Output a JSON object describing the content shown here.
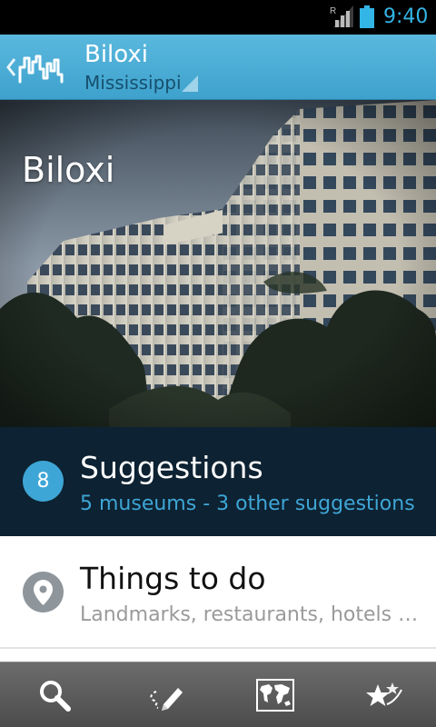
{
  "status_bar": {
    "time": "9:40",
    "network_label": "R",
    "icons": [
      "signal-icon",
      "battery-icon"
    ]
  },
  "action_bar": {
    "title": "Biloxi",
    "subtitle": "Mississippi",
    "icons": [
      "up-chevron-icon",
      "skyline-logo-icon",
      "spinner-arrow-icon"
    ]
  },
  "hero": {
    "title": "Biloxi"
  },
  "suggestions": {
    "count": "8",
    "title": "Suggestions",
    "subtitle": "5 museums - 3 other suggestions"
  },
  "things_to_do": {
    "title": "Things to do",
    "subtitle": "Landmarks, restaurants, hotels …",
    "icon": "map-pin-icon"
  },
  "bottom_bar": {
    "items": [
      "search-icon",
      "itinerary-pencil-icon",
      "world-map-icon",
      "favorites-stars-icon"
    ]
  },
  "colors": {
    "accent": "#33b5e5",
    "action_bar": "#4aaed6",
    "suggestions_bg": "#0d2232",
    "badge": "#3ea6d6",
    "bottom_bar": "#5a5a5a"
  }
}
